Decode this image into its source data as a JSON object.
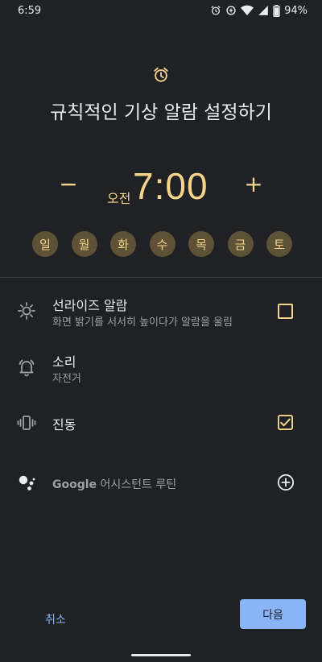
{
  "status": {
    "time": "6:59",
    "battery": "94%",
    "icons": [
      "alarm-icon",
      "data-saver-icon",
      "wifi-icon",
      "signal-icon",
      "battery-icon"
    ]
  },
  "header": {
    "icon": "alarm-clock-icon",
    "title": "규칙적인 기상 알람 설정하기"
  },
  "time_picker": {
    "minus_label": "−",
    "plus_label": "+",
    "ampm": "오전",
    "time": "7:00"
  },
  "days": [
    {
      "label": "일",
      "selected": true
    },
    {
      "label": "월",
      "selected": true
    },
    {
      "label": "화",
      "selected": true
    },
    {
      "label": "수",
      "selected": true
    },
    {
      "label": "목",
      "selected": true
    },
    {
      "label": "금",
      "selected": true
    },
    {
      "label": "토",
      "selected": true
    }
  ],
  "settings": {
    "sunrise": {
      "title": "선라이즈 알람",
      "subtitle": "화면 밝기를 서서히 높이다가 알람을 울림",
      "checked": false,
      "icon": "brightness-icon"
    },
    "sound": {
      "title": "소리",
      "subtitle": "자전거",
      "icon": "bell-icon"
    },
    "vibrate": {
      "title": "진동",
      "checked": true,
      "icon": "vibration-icon"
    },
    "assistant": {
      "brand": "Google",
      "label": "어시스턴트 루틴",
      "icon": "google-assistant-icon",
      "action_icon": "add-circle-icon"
    }
  },
  "footer": {
    "cancel": "취소",
    "next": "다음"
  },
  "colors": {
    "background": "#202124",
    "accent": "#f3d48a",
    "day_bg": "#5d5136",
    "primary_button": "#8ab4f8"
  }
}
